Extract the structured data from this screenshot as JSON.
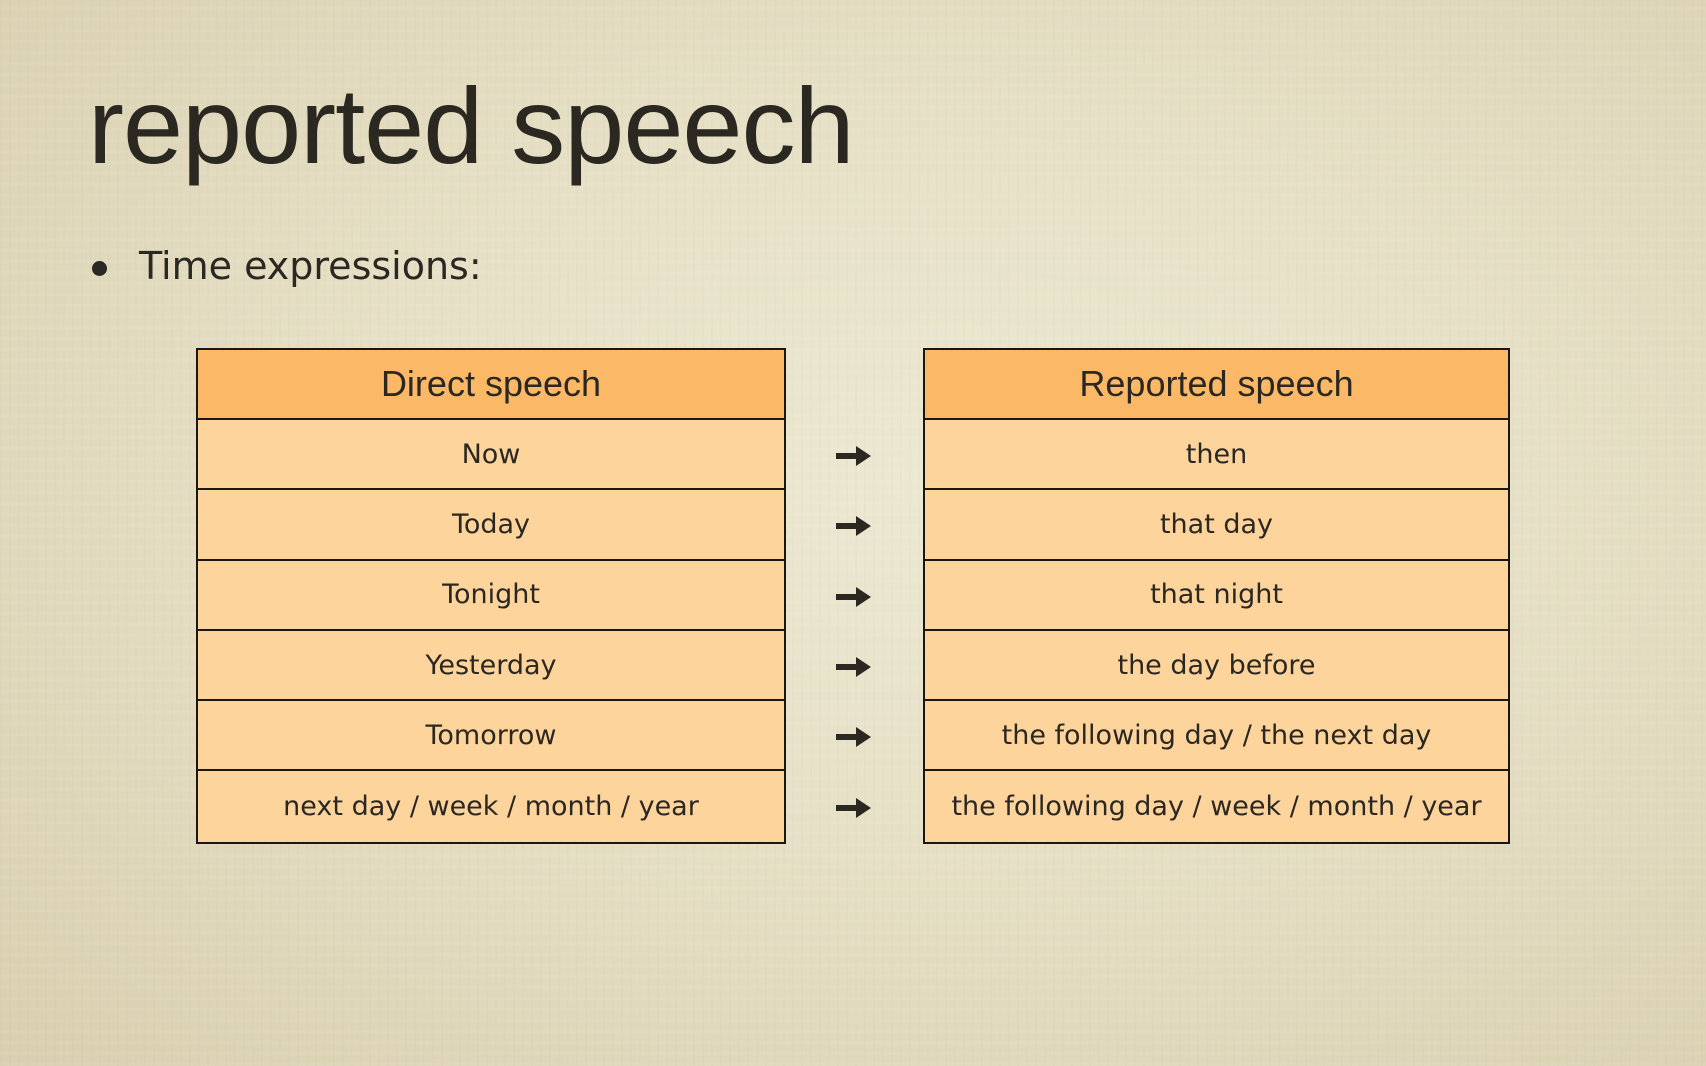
{
  "slide": {
    "title": "reported speech",
    "bullet": "Time expressions:"
  },
  "table": {
    "left_header": "Direct speech",
    "right_header": "Reported speech",
    "arrow_icon": "right-arrow",
    "rows": [
      {
        "direct": "Now",
        "reported": "then"
      },
      {
        "direct": "Today",
        "reported": "that day"
      },
      {
        "direct": "Tonight",
        "reported": "that night"
      },
      {
        "direct": "Yesterday",
        "reported": "the day before"
      },
      {
        "direct": "Tomorrow",
        "reported": "the following day / the next day"
      },
      {
        "direct": "next day / week / month / year",
        "reported": "the following day / week / month / year"
      }
    ]
  },
  "colors": {
    "header_fill": "#fbb968",
    "cell_fill": "#fed49d",
    "border": "#1a1713",
    "text": "#2b2721"
  }
}
